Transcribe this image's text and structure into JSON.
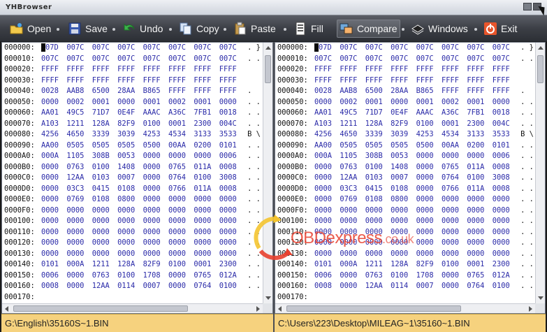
{
  "window": {
    "title": "YHBrowser"
  },
  "toolbar": {
    "open": "Open",
    "save": "Save",
    "undo": "Undo",
    "copy": "Copy",
    "paste": "Paste",
    "fill": "Fill",
    "compare": "Compare",
    "windows": "Windows",
    "exit": "Exit"
  },
  "colors": {
    "toolbar": "#3c3f46",
    "status": "#f6d27e",
    "hex_word": "#2a2aa8",
    "watermark": "#e8402f"
  },
  "icons": [
    "open-folder-icon",
    "save-disk-icon",
    "undo-arrow-icon",
    "copy-icon",
    "paste-clipboard-icon",
    "fill-icon",
    "compare-icon",
    "windows-icon",
    "exit-power-icon"
  ],
  "left_file": "G:\\English\\35160S~1.BIN",
  "right_file": "C:\\Users\\223\\Desktop\\MILEAG~1\\35160~1.BIN",
  "watermark": {
    "brand": "OBDexpress",
    "domain": ".co.uk"
  },
  "rows": [
    {
      "addr": "000000:",
      "words": [
        "007D",
        "007C",
        "007C",
        "007C",
        "007C",
        "007C",
        "007C",
        "007C"
      ],
      "ascii": ". }"
    },
    {
      "addr": "000010:",
      "words": [
        "007C",
        "007C",
        "007C",
        "007C",
        "007C",
        "007C",
        "007C",
        "007C"
      ],
      "ascii": ". ."
    },
    {
      "addr": "000020:",
      "words": [
        "FFFF",
        "FFFF",
        "FFFF",
        "FFFF",
        "FFFF",
        "FFFF",
        "FFFF",
        "FFFF"
      ],
      "ascii": ""
    },
    {
      "addr": "000030:",
      "words": [
        "FFFF",
        "FFFF",
        "FFFF",
        "FFFF",
        "FFFF",
        "FFFF",
        "FFFF",
        "FFFF"
      ],
      "ascii": ""
    },
    {
      "addr": "000040:",
      "words": [
        "0028",
        "AAB8",
        "6500",
        "28AA",
        "B865",
        "FFFF",
        "FFFF",
        "FFFF"
      ],
      "ascii": "."
    },
    {
      "addr": "000050:",
      "words": [
        "0000",
        "0002",
        "0001",
        "0000",
        "0001",
        "0002",
        "0001",
        "0000"
      ],
      "ascii": ". ."
    },
    {
      "addr": "000060:",
      "words": [
        "AA01",
        "49C5",
        "71D7",
        "0E4F",
        "AAAC",
        "A36C",
        "7FB1",
        "0018"
      ],
      "ascii": ". ."
    },
    {
      "addr": "000070:",
      "words": [
        "A103",
        "1211",
        "128A",
        "82F9",
        "0100",
        "0001",
        "2300",
        "004C"
      ],
      "ascii": ". ."
    },
    {
      "addr": "000080:",
      "words": [
        "4256",
        "4650",
        "3339",
        "3039",
        "4253",
        "4534",
        "3133",
        "3533"
      ],
      "ascii": "B \\"
    },
    {
      "addr": "000090:",
      "words": [
        "AA00",
        "0505",
        "0505",
        "0505",
        "0500",
        "00AA",
        "0200",
        "0101"
      ],
      "ascii": ". ."
    },
    {
      "addr": "0000A0:",
      "words": [
        "000A",
        "1105",
        "308B",
        "0053",
        "0000",
        "0000",
        "0000",
        "0006"
      ],
      "ascii": ". ."
    },
    {
      "addr": "0000B0:",
      "words": [
        "0000",
        "0763",
        "0100",
        "1408",
        "0000",
        "0765",
        "011A",
        "0008"
      ],
      "ascii": ". ."
    },
    {
      "addr": "0000C0:",
      "words": [
        "0000",
        "12AA",
        "0103",
        "0007",
        "0000",
        "0764",
        "0100",
        "3008"
      ],
      "ascii": ". ."
    },
    {
      "addr": "0000D0:",
      "words": [
        "0000",
        "03C3",
        "0415",
        "0108",
        "0000",
        "0766",
        "011A",
        "0008"
      ],
      "ascii": ". ."
    },
    {
      "addr": "0000E0:",
      "words": [
        "0000",
        "0769",
        "0108",
        "0800",
        "0000",
        "0000",
        "0000",
        "0000"
      ],
      "ascii": ". ."
    },
    {
      "addr": "0000F0:",
      "words": [
        "0000",
        "0000",
        "0000",
        "0000",
        "0000",
        "0000",
        "0000",
        "0000"
      ],
      "ascii": ". ."
    },
    {
      "addr": "000100:",
      "words": [
        "0000",
        "0000",
        "0000",
        "0000",
        "0000",
        "0000",
        "0000",
        "0000"
      ],
      "ascii": ". ."
    },
    {
      "addr": "000110:",
      "words": [
        "0000",
        "0000",
        "0000",
        "0000",
        "0000",
        "0000",
        "0000",
        "0000"
      ],
      "ascii": ". ."
    },
    {
      "addr": "000120:",
      "words": [
        "0000",
        "0000",
        "0000",
        "0000",
        "0000",
        "0000",
        "0000",
        "0000"
      ],
      "ascii": ". ."
    },
    {
      "addr": "000130:",
      "words": [
        "0000",
        "0000",
        "0000",
        "0000",
        "0000",
        "0000",
        "0000",
        "0000"
      ],
      "ascii": ". ."
    },
    {
      "addr": "000140:",
      "words": [
        "0101",
        "000A",
        "1211",
        "128A",
        "82F9",
        "0100",
        "0001",
        "2300"
      ],
      "ascii": ". ."
    },
    {
      "addr": "000150:",
      "words": [
        "0006",
        "0000",
        "0763",
        "0100",
        "1708",
        "0000",
        "0765",
        "012A"
      ],
      "ascii": ". ."
    },
    {
      "addr": "000160:",
      "words": [
        "0008",
        "0000",
        "12AA",
        "0114",
        "0007",
        "0000",
        "0764",
        "0100"
      ],
      "ascii": ". ."
    },
    {
      "addr": "000170:",
      "words": [],
      "ascii": ""
    }
  ]
}
